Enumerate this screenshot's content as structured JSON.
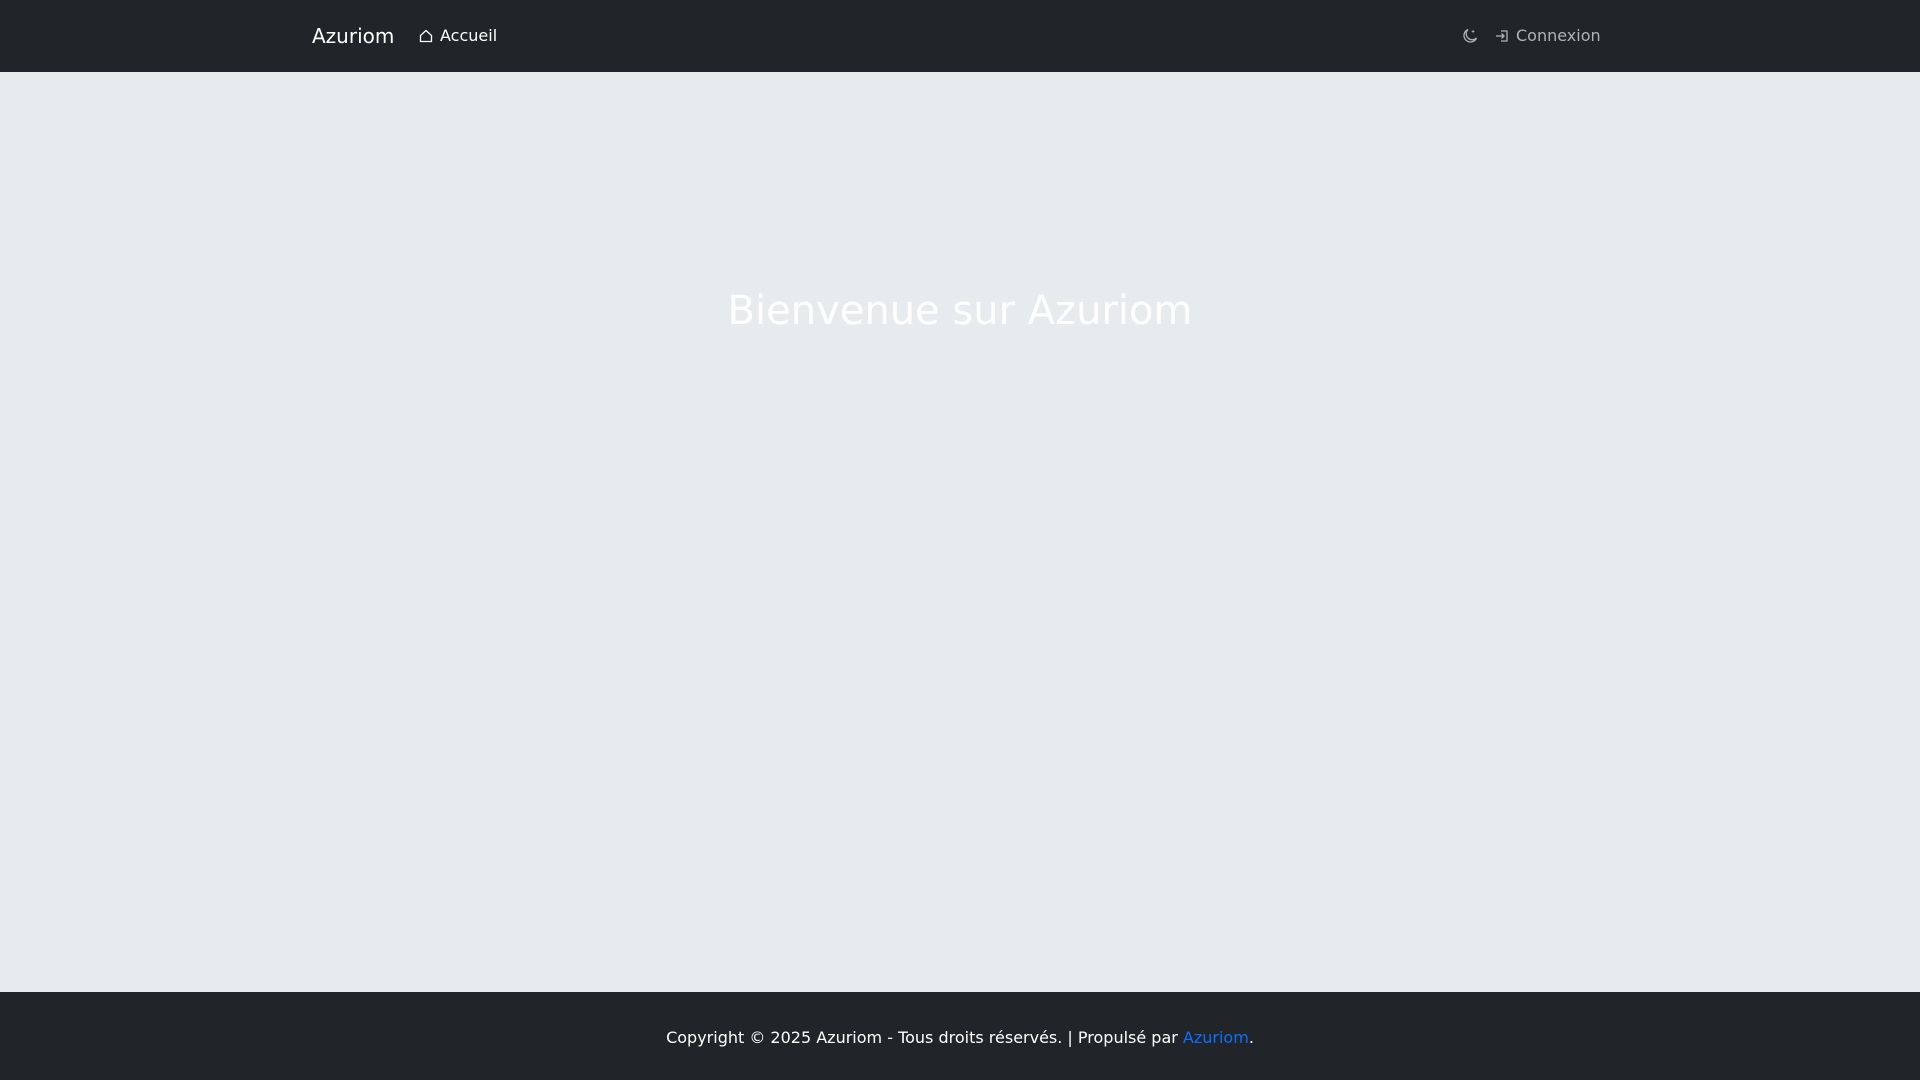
{
  "navbar": {
    "brand": "Azuriom",
    "home_label": "Accueil",
    "home_icon": "house-icon",
    "theme_icon": "moon-stars-icon",
    "login_label": "Connexion",
    "login_icon": "box-arrow-in-right-icon"
  },
  "main": {
    "title": "Bienvenue sur Azuriom"
  },
  "footer": {
    "copyright": "Copyright © 2025 Azuriom - Tous droits réservés. | Propulsé par ",
    "link_label": "Azuriom",
    "suffix": "."
  },
  "colors": {
    "navbar_bg": "#212529",
    "page_bg": "#e7ebee",
    "link": "#0d6efd"
  }
}
